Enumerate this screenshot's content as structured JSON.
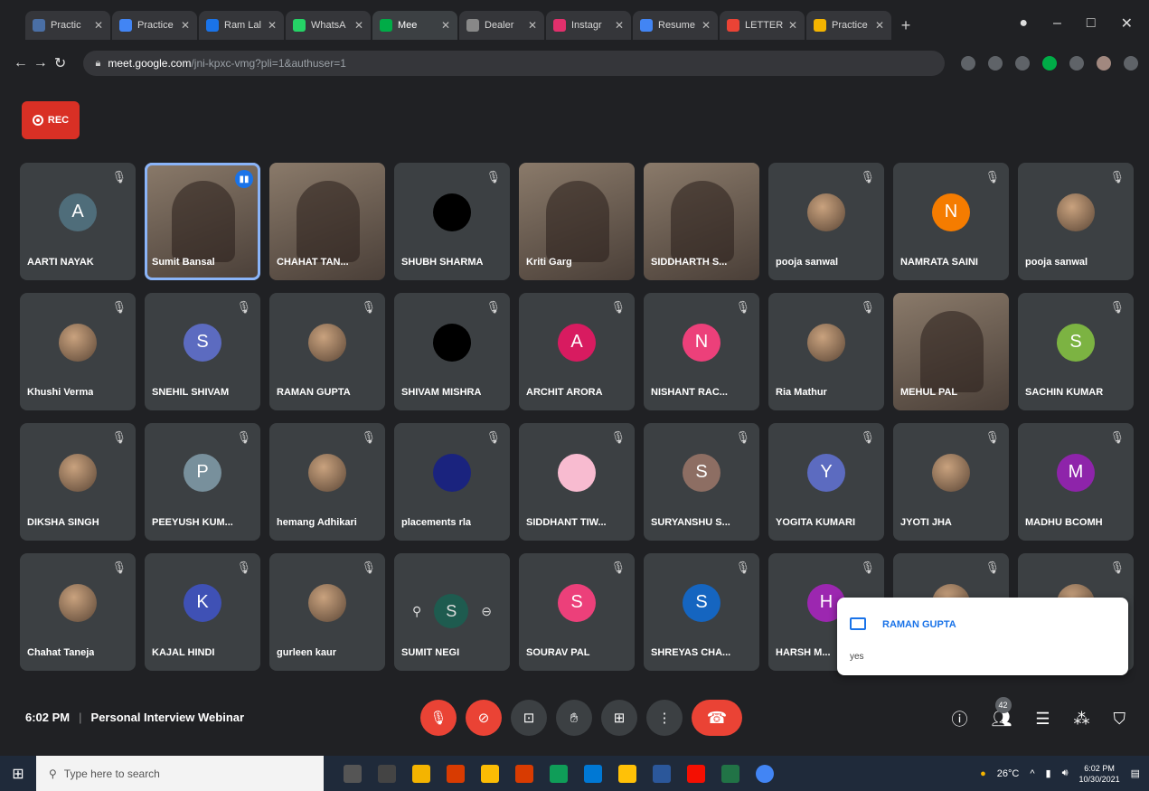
{
  "browser": {
    "tabs": [
      {
        "title": "Practic",
        "color": "#4a6fa5"
      },
      {
        "title": "Practice",
        "color": "#4285f4"
      },
      {
        "title": "Ram Lal",
        "color": "#1a73e8"
      },
      {
        "title": "WhatsA",
        "color": "#25d366"
      },
      {
        "title": "Mee",
        "color": "#00ac47",
        "active": true
      },
      {
        "title": "Dealer",
        "color": "#888888"
      },
      {
        "title": "Instagr",
        "color": "#e1306c"
      },
      {
        "title": "Resume",
        "color": "#4285f4"
      },
      {
        "title": "LETTER",
        "color": "#ea4335"
      },
      {
        "title": "Practice",
        "color": "#f4b400"
      }
    ],
    "url_host": "meet.google.com",
    "url_path": "/jni-kpxc-vmg?pli=1&authuser=1"
  },
  "rec_label": "REC",
  "participants": [
    {
      "name": "AARTI NAYAK",
      "initial": "A",
      "color": "#4f6d7a",
      "type": "initial"
    },
    {
      "name": "Sumit Bansal",
      "type": "video",
      "speaking": true
    },
    {
      "name": "CHAHAT TAN...",
      "type": "video"
    },
    {
      "name": "SHUBH SHARMA",
      "type": "photo",
      "color": "#000000"
    },
    {
      "name": "Kriti Garg",
      "type": "video"
    },
    {
      "name": "SIDDHARTH S...",
      "type": "video"
    },
    {
      "name": "pooja sanwal",
      "type": "photo"
    },
    {
      "name": "NAMRATA SAINI",
      "initial": "N",
      "color": "#f57c00",
      "type": "initial"
    },
    {
      "name": "pooja sanwal",
      "type": "photo"
    },
    {
      "name": "Khushi Verma",
      "type": "photo"
    },
    {
      "name": "SNEHIL SHIVAM",
      "initial": "S",
      "color": "#5c6bc0",
      "type": "initial"
    },
    {
      "name": "RAMAN GUPTA",
      "type": "photo"
    },
    {
      "name": "SHIVAM MISHRA",
      "type": "photo",
      "color": "#000000"
    },
    {
      "name": "ARCHIT ARORA",
      "initial": "A",
      "color": "#d81b60",
      "type": "initial"
    },
    {
      "name": "NISHANT RAC...",
      "initial": "N",
      "color": "#ec407a",
      "type": "initial"
    },
    {
      "name": "Ria Mathur",
      "type": "photo"
    },
    {
      "name": "MEHUL PAL",
      "type": "video"
    },
    {
      "name": "SACHIN KUMAR",
      "initial": "S",
      "color": "#7cb342",
      "type": "initial"
    },
    {
      "name": "DIKSHA SINGH",
      "type": "photo"
    },
    {
      "name": "PEEYUSH KUM...",
      "initial": "P",
      "color": "#78909c",
      "type": "initial"
    },
    {
      "name": "hemang Adhikari",
      "type": "photo"
    },
    {
      "name": "placements rla",
      "type": "photo",
      "color": "#1a237e"
    },
    {
      "name": "SIDDHANT TIW...",
      "type": "photo",
      "color": "#f8bbd0"
    },
    {
      "name": "SURYANSHU S...",
      "initial": "S",
      "color": "#8d6e63",
      "type": "initial"
    },
    {
      "name": "YOGITA KUMARI",
      "initial": "Y",
      "color": "#5c6bc0",
      "type": "initial"
    },
    {
      "name": "JYOTI JHA",
      "type": "photo"
    },
    {
      "name": "MADHU BCOMH",
      "initial": "M",
      "color": "#8e24aa",
      "type": "initial"
    },
    {
      "name": "Chahat Taneja",
      "type": "photo"
    },
    {
      "name": "KAJAL HINDI",
      "initial": "K",
      "color": "#3f51b5",
      "type": "initial"
    },
    {
      "name": "gurleen kaur",
      "type": "photo"
    },
    {
      "name": "SUMIT NEGI",
      "initial": "S",
      "color": "#1e5b4f",
      "type": "hover"
    },
    {
      "name": "SOURAV PAL",
      "initial": "S",
      "color": "#ec407a",
      "type": "initial"
    },
    {
      "name": "SHREYAS CHA...",
      "initial": "S",
      "color": "#1565c0",
      "type": "initial"
    },
    {
      "name": "HARSH M...",
      "initial": "H",
      "color": "#9c27b0",
      "type": "initial"
    },
    {
      "name": "",
      "type": "photo"
    },
    {
      "name": "",
      "type": "photo"
    }
  ],
  "chat_toast": {
    "sender": "RAMAN GUPTA",
    "message": "yes"
  },
  "meeting": {
    "time": "6:02 PM",
    "title": "Personal Interview Webinar",
    "participant_count": "42"
  },
  "taskbar": {
    "search_placeholder": "Type here to search",
    "weather": "26°C",
    "time": "6:02 PM",
    "date": "10/30/2021"
  }
}
